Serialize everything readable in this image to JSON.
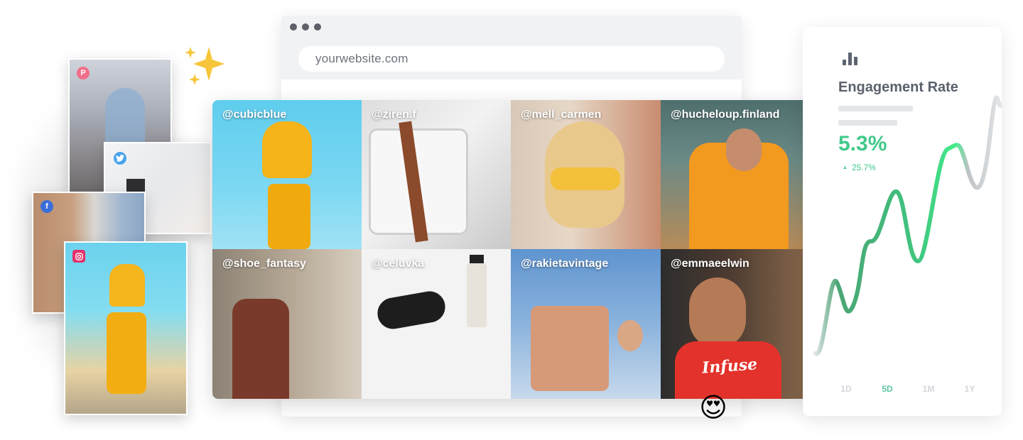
{
  "browser": {
    "url": "yourwebsite.com"
  },
  "social_cards": [
    {
      "platform": "Pinterest",
      "icon": "pinterest-icon",
      "color": "#f26f8a"
    },
    {
      "platform": "Twitter",
      "icon": "twitter-icon",
      "color": "#4aa4ec"
    },
    {
      "platform": "Facebook",
      "icon": "facebook-icon",
      "color": "#3b6ed9"
    },
    {
      "platform": "Instagram",
      "icon": "instagram-icon",
      "color": "#e2326b"
    }
  ],
  "feed": {
    "posts": [
      {
        "handle": "@cubicblue"
      },
      {
        "handle": "@ziren.f"
      },
      {
        "handle": "@mell_carmen"
      },
      {
        "handle": "@hucheloup.finland"
      },
      {
        "handle": "@shoe_fantasy"
      },
      {
        "handle": "@celuvka"
      },
      {
        "handle": "@rakietavintage"
      },
      {
        "handle": "@emmaeelwin"
      }
    ],
    "tshirt_text": "Infuse"
  },
  "emoji": "😍",
  "engagement": {
    "title": "Engagement Rate",
    "value": "5.3%",
    "change": "25.7%",
    "change_arrow": "▲",
    "accent_color": "#41c98a",
    "ranges": [
      "1D",
      "5D",
      "1M",
      "1Y"
    ],
    "active_range": "5D"
  }
}
